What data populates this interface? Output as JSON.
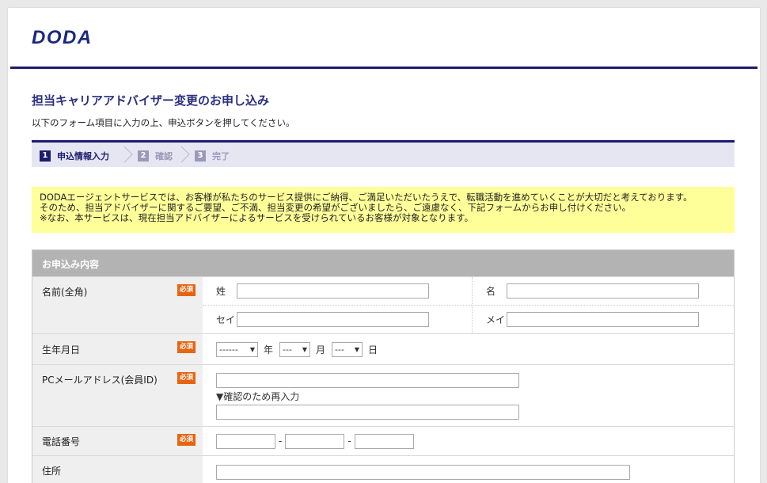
{
  "logo": "DODA",
  "title": "担当キャリアアドバイザー変更のお申し込み",
  "lead": "以下のフォーム項目に入力の上、申込ボタンを押してください。",
  "steps": [
    {
      "num": "1",
      "label": "申込情報入力"
    },
    {
      "num": "2",
      "label": "確認"
    },
    {
      "num": "3",
      "label": "完了"
    }
  ],
  "notice": {
    "line1": "DODAエージェントサービスでは、お客様が私たちのサービス提供にご納得、ご満足いただいたうえで、転職活動を進めていくことが大切だと考えております。",
    "line2": "そのため、担当アドバイザーに関するご要望、ご不満、担当変更の希望がございましたら、ご遠慮なく、下記フォームからお申し付けください。",
    "line3": "※なお、本サービスは、現在担当アドバイザーによるサービスを受けられているお客様が対象となります。"
  },
  "form": {
    "header": "お申込み内容",
    "required": "必須",
    "name": {
      "label": "名前(全角)",
      "sei": "姓",
      "mei": "名",
      "sei_kana": "セイ",
      "mei_kana": "メイ"
    },
    "birth": {
      "label": "生年月日",
      "year_value": "------",
      "year_unit": "年",
      "month_value": "---",
      "month_unit": "月",
      "day_value": "---",
      "day_unit": "日"
    },
    "email": {
      "label": "PCメールアドレス(会員ID)",
      "confirm": "▼確認のため再入力"
    },
    "phone": {
      "label": "電話番号",
      "sep": "-"
    },
    "address": {
      "label": "住所"
    }
  }
}
